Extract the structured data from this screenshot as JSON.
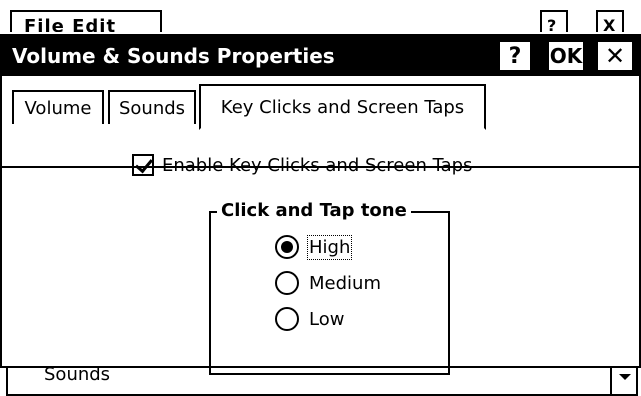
{
  "background": {
    "field_text": "File  Edit",
    "btn1": "?",
    "btn2": "X",
    "bottom_select_value": "Sounds"
  },
  "dialog": {
    "title": "Volume & Sounds Properties",
    "help_label": "?",
    "ok_label": "OK",
    "close_label": "✕"
  },
  "tabs": [
    {
      "label": "Volume",
      "active": false
    },
    {
      "label": "Sounds",
      "active": false
    },
    {
      "label": "Key Clicks and Screen Taps",
      "active": true
    }
  ],
  "content": {
    "enable_label": "Enable Key Clicks and Screen Taps",
    "enable_checked": true,
    "group_title": "Click and Tap tone",
    "options": [
      {
        "label": "High",
        "selected": true
      },
      {
        "label": "Medium",
        "selected": false
      },
      {
        "label": "Low",
        "selected": false
      }
    ]
  }
}
